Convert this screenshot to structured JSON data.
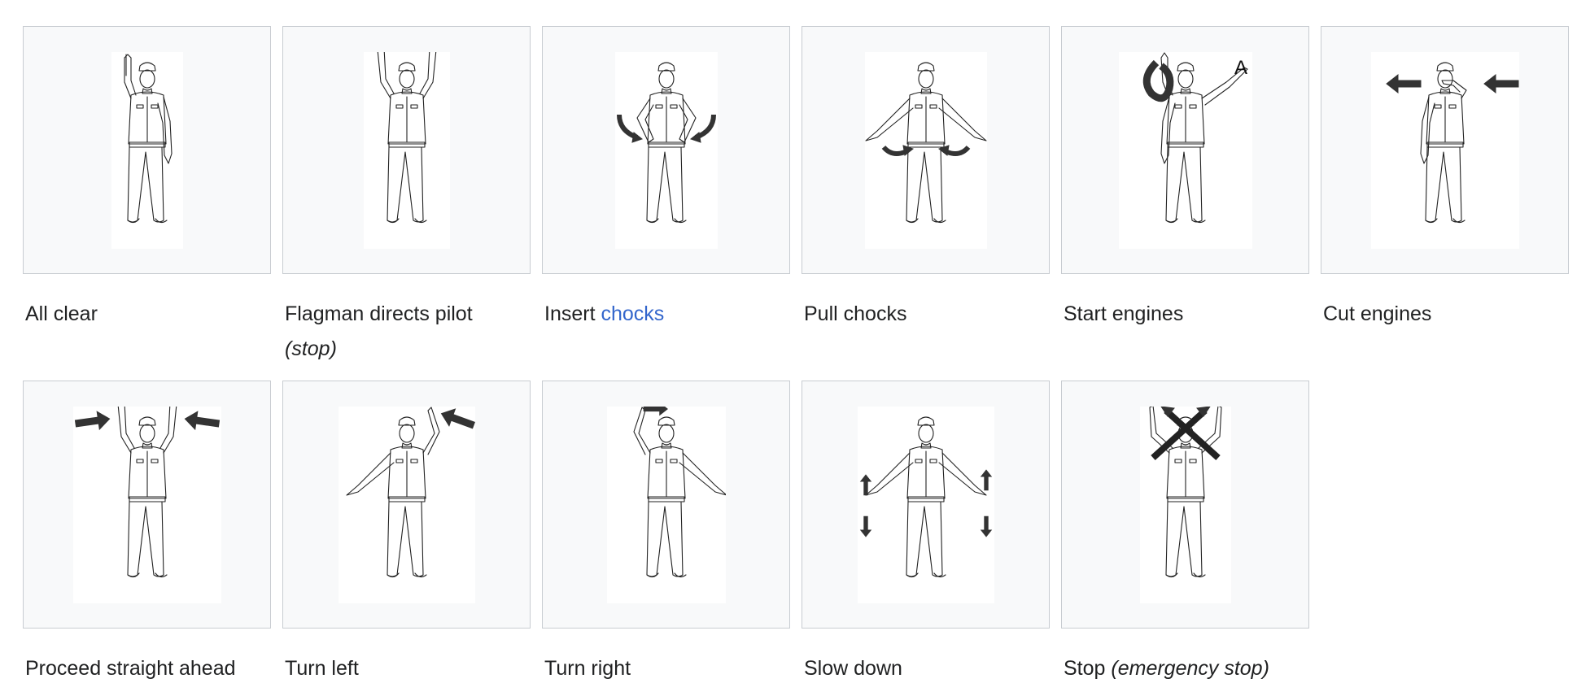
{
  "gallery": {
    "items": [
      {
        "caption": "All clear",
        "pose": "all-clear"
      },
      {
        "caption": "Flagman directs pilot",
        "caption_em": "(stop)",
        "pose": "flagman-stop"
      },
      {
        "caption": "Insert",
        "caption_link": "chocks",
        "pose": "insert-chocks"
      },
      {
        "caption": "Pull chocks",
        "pose": "pull-chocks"
      },
      {
        "caption": "Start engines",
        "figure_label": "A",
        "pose": "start-engines"
      },
      {
        "caption": "Cut engines",
        "pose": "cut-engines"
      },
      {
        "caption": "Proceed straight ahead",
        "pose": "proceed-straight"
      },
      {
        "caption": "Turn left",
        "pose": "turn-left"
      },
      {
        "caption": "Turn right",
        "pose": "turn-right"
      },
      {
        "caption": "Slow down",
        "pose": "slow-down"
      },
      {
        "caption": "Stop",
        "caption_em": "(emergency stop)",
        "pose": "emergency-stop"
      }
    ]
  },
  "colors": {
    "frame_border": "#c8ccd1",
    "frame_bg": "#f8f9fa",
    "link": "#3366cc",
    "text": "#202122"
  }
}
